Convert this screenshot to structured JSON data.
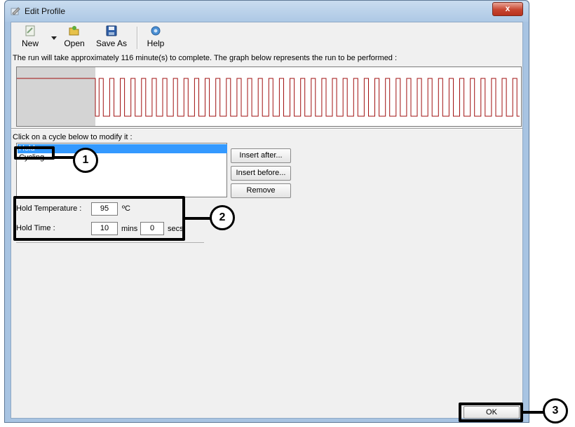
{
  "window": {
    "title": "Edit Profile",
    "close_label": "x"
  },
  "toolbar": {
    "new_label": "New",
    "open_label": "Open",
    "save_as_label": "Save As",
    "help_label": "Help"
  },
  "info_text": "The run will take approximately 116 minute(s) to complete. The graph below represents the run to be performed :",
  "graph": {
    "pulse_count": 40,
    "line_color": "#a01010"
  },
  "cycles": {
    "prompt": "Click on a cycle below to modify it :",
    "items": [
      {
        "label": "Hold",
        "selected": true
      },
      {
        "label": "Cycling",
        "selected": false
      }
    ],
    "insert_after_label": "Insert after...",
    "insert_before_label": "Insert before...",
    "remove_label": "Remove"
  },
  "hold": {
    "temperature_label": "Hold Temperature :",
    "temperature_value": "95",
    "temperature_unit": "ºC",
    "time_label": "Hold Time :",
    "minutes_value": "10",
    "minutes_unit": "mins",
    "seconds_value": "0",
    "seconds_unit": "secs"
  },
  "ok_label": "OK",
  "annotations": {
    "one": "1",
    "two": "2",
    "three": "3"
  }
}
